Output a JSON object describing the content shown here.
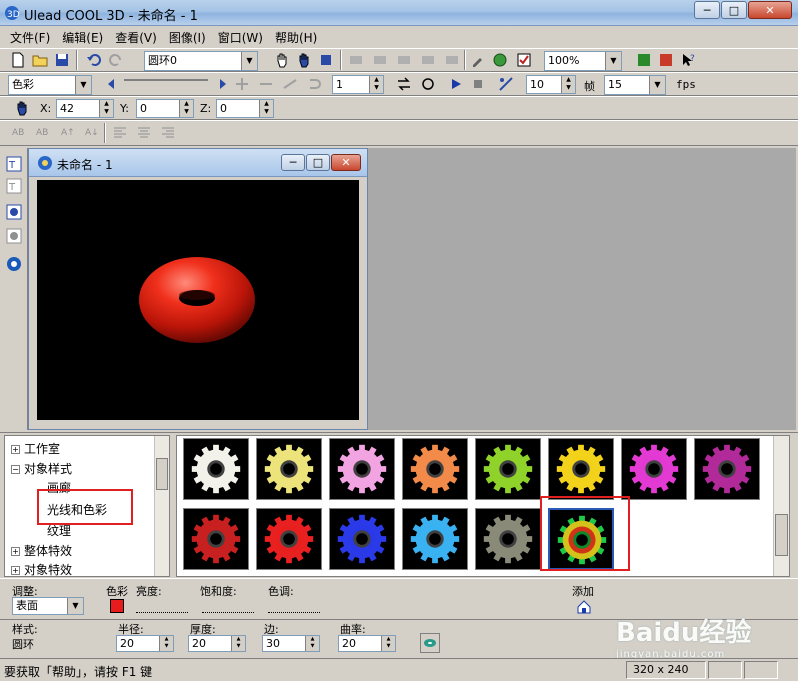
{
  "window": {
    "title": "Ulead COOL 3D - 未命名 - 1",
    "minimize": "─",
    "maximize": "□",
    "close": "✕"
  },
  "menu": [
    "文件(F)",
    "编辑(E)",
    "查看(V)",
    "图像(I)",
    "窗口(W)",
    "帮助(H)"
  ],
  "toolbar1": {
    "object_select": "圆环0",
    "zoom": "100%"
  },
  "toolbar2": {
    "attribute_select": "色彩",
    "frame_value": "1",
    "speed_value": "10",
    "frame_label": "帧",
    "frame_count": "15",
    "fps_label": "fps"
  },
  "toolbar3": {
    "x_label": "X:",
    "x_value": "42",
    "y_label": "Y:",
    "y_value": "0",
    "z_label": "Z:",
    "z_value": "0"
  },
  "child_window": {
    "title": "未命名 - 1"
  },
  "tree": {
    "items": [
      {
        "label": "工作室",
        "sign": "+",
        "indent": 0
      },
      {
        "label": "对象样式",
        "sign": "−",
        "indent": 0
      },
      {
        "label": "画廊",
        "sign": "",
        "indent": 1
      },
      {
        "label": "光线和色彩",
        "sign": "",
        "indent": 1
      },
      {
        "label": "纹理",
        "sign": "",
        "indent": 1
      },
      {
        "label": "整体特效",
        "sign": "+",
        "indent": 0
      },
      {
        "label": "对象特效",
        "sign": "+",
        "indent": 0
      }
    ]
  },
  "gallery": {
    "colors": [
      "#f2f2ea",
      "#ece47a",
      "#f2a4e2",
      "#f28a4a",
      "#8ed22a",
      "#f2d21a",
      "#e23ad2",
      "#b22a9a",
      "#c82020",
      "#e82020",
      "#2a3ae8",
      "#3ab2f2",
      "#8a8a78",
      "#20c848"
    ]
  },
  "props": {
    "adjust_label": "调整:",
    "adjust_value": "表面",
    "color_label": "色彩",
    "brightness_label": "亮度:",
    "saturation_label": "饱和度:",
    "hue_label": "色调:",
    "add_label": "添加",
    "style_label": "样式:",
    "style_value": "圆环",
    "radius_label": "半径:",
    "radius_value": "20",
    "thickness_label": "厚度:",
    "thickness_value": "20",
    "edge_label": "边:",
    "edge_value": "30",
    "curvature_label": "曲率:",
    "curvature_value": "20",
    "swatch_color": "#e81c1c"
  },
  "status": {
    "message": "要获取「帮助」，请按 F1 键",
    "size": "320 x 240"
  },
  "watermark": {
    "text": "Baidu经验",
    "sub": "jingyan.baidu.com"
  }
}
